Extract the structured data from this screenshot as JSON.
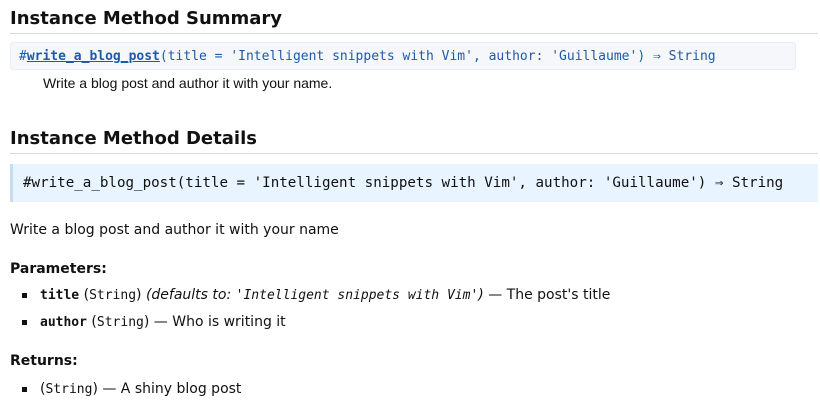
{
  "summary": {
    "heading": "Instance Method Summary",
    "signature": {
      "prefix": "#",
      "method_name": "write_a_blog_post",
      "params": "(title = 'Intelligent snippets with Vim', author: 'Guillaume')",
      "arrow": " ⇒ ",
      "return_type": "String"
    },
    "description": "Write a blog post and author it with your name."
  },
  "details": {
    "heading": "Instance Method Details",
    "signature": "#write_a_blog_post(title = 'Intelligent snippets with Vim', author: 'Guillaume') ⇒ String",
    "description": "Write a blog post and author it with your name",
    "parameters": {
      "title": "Parameters:",
      "items": [
        {
          "name": "title",
          "type_open": " (",
          "type": "String",
          "type_close": ")",
          "default_label": " (defaults to: ",
          "default_value": "'Intelligent snippets with Vim'",
          "default_close": ")",
          "description": " — The post's title"
        },
        {
          "name": "author",
          "type_open": " (",
          "type": "String",
          "type_close": ")",
          "description": " — Who is writing it"
        }
      ]
    },
    "returns": {
      "title": "Returns:",
      "items": [
        {
          "type_open": "(",
          "type": "String",
          "type_close": ")",
          "description": " — A shiny blog post"
        }
      ]
    }
  }
}
